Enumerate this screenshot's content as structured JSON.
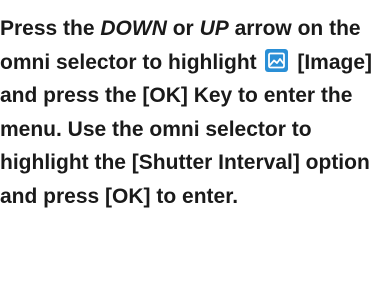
{
  "instruction": {
    "press": "Press the ",
    "down": "DOWN",
    "or": " or ",
    "up": "UP",
    "arrow_text": " arrow on the omni selector to highlight ",
    "image_label": " [Image] and press the [OK] Key to enter the menu. Use the omni selector to highlight the [Shutter Interval] option and press [OK] to enter.",
    "icon": "image-menu-icon"
  },
  "colors": {
    "text": "#1a1a1a",
    "icon_bg": "#2a8fd6",
    "icon_fg": "#ffffff"
  }
}
